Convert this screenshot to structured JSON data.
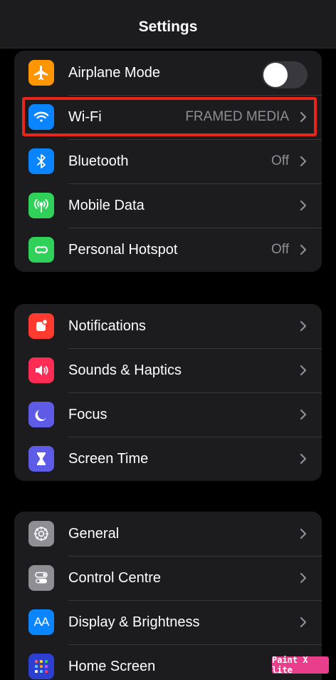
{
  "nav": {
    "title": "Settings"
  },
  "groups": [
    {
      "rows": [
        {
          "label": "Airplane Mode",
          "icon": "airplane-icon",
          "color": "#ff9500",
          "toggle_on": false
        },
        {
          "label": "Wi-Fi",
          "value": "FRAMED MEDIA",
          "icon": "wifi-icon",
          "color": "#0a84ff"
        },
        {
          "label": "Bluetooth",
          "value": "Off",
          "icon": "bluetooth-icon",
          "color": "#0a84ff"
        },
        {
          "label": "Mobile Data",
          "icon": "antenna-icon",
          "color": "#30d158"
        },
        {
          "label": "Personal Hotspot",
          "value": "Off",
          "icon": "hotspot-link-icon",
          "color": "#30d158"
        }
      ]
    },
    {
      "rows": [
        {
          "label": "Notifications",
          "icon": "notification-bell-icon",
          "color": "#ff3b30"
        },
        {
          "label": "Sounds & Haptics",
          "icon": "speaker-icon",
          "color": "#ff2d55"
        },
        {
          "label": "Focus",
          "icon": "moon-icon",
          "color": "#5e5ce6"
        },
        {
          "label": "Screen Time",
          "icon": "hourglass-icon",
          "color": "#5e5ce6"
        }
      ]
    },
    {
      "rows": [
        {
          "label": "General",
          "icon": "gear-icon",
          "color": "#8e8e93"
        },
        {
          "label": "Control Centre",
          "icon": "switches-icon",
          "color": "#8e8e93"
        },
        {
          "label": "Display & Brightness",
          "icon": "text-size-icon",
          "color": "#0a84ff",
          "icon_text": "AA"
        },
        {
          "label": "Home Screen",
          "icon": "app-grid-icon",
          "color": "#2c3fd1"
        }
      ]
    }
  ],
  "annotation": {
    "highlight_color": "#e8241b"
  },
  "watermark": {
    "text": "Paint X lite"
  }
}
